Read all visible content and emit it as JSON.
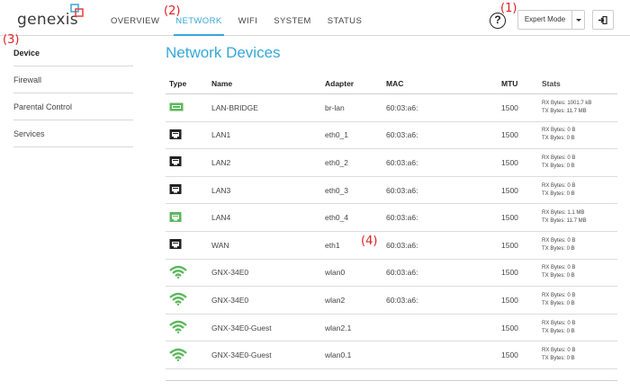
{
  "header": {
    "logo": "genexis",
    "nav": [
      {
        "label": "OVERVIEW",
        "active": false
      },
      {
        "label": "NETWORK",
        "active": true
      },
      {
        "label": "WIFI",
        "active": false
      },
      {
        "label": "SYSTEM",
        "active": false
      },
      {
        "label": "STATUS",
        "active": false
      }
    ],
    "help": "?",
    "mode_button": "Expert Mode",
    "logout_icon": "logout-icon"
  },
  "markers": [
    "(1)",
    "(2)",
    "(3)",
    "(4)"
  ],
  "sidebar": {
    "items": [
      {
        "label": "Device",
        "active": true
      },
      {
        "label": "Firewall",
        "active": false
      },
      {
        "label": "Parental Control",
        "active": false
      },
      {
        "label": "Services",
        "active": false
      }
    ]
  },
  "main": {
    "title": "Network Devices",
    "columns": [
      "Type",
      "Name",
      "Adapter",
      "MAC",
      "MTU",
      "Stats"
    ],
    "rows": [
      {
        "type": "bridge-icon",
        "name": "LAN-BRIDGE",
        "adapter": "br-lan",
        "mac": "60:03:a6:",
        "mtu": "1500",
        "rx": "RX Bytes: 1001.7 kB",
        "tx": "TX Bytes: 11.7 MB"
      },
      {
        "type": "ethernet-icon",
        "name": "LAN1",
        "adapter": "eth0_1",
        "mac": "60:03:a6:",
        "mtu": "1500",
        "rx": "RX Bytes: 0 B",
        "tx": "TX Bytes: 0 B"
      },
      {
        "type": "ethernet-icon",
        "name": "LAN2",
        "adapter": "eth0_2",
        "mac": "60:03:a6:",
        "mtu": "1500",
        "rx": "RX Bytes: 0 B",
        "tx": "TX Bytes: 0 B"
      },
      {
        "type": "ethernet-icon",
        "name": "LAN3",
        "adapter": "eth0_3",
        "mac": "60:03:a6:",
        "mtu": "1500",
        "rx": "RX Bytes: 0 B",
        "tx": "TX Bytes: 0 B"
      },
      {
        "type": "ethernet-active-icon",
        "name": "LAN4",
        "adapter": "eth0_4",
        "mac": "60:03:a6:",
        "mtu": "1500",
        "rx": "RX Bytes: 1.1 MB",
        "tx": "TX Bytes: 11.7 MB"
      },
      {
        "type": "ethernet-icon",
        "name": "WAN",
        "adapter": "eth1",
        "mac": "60:03:a6:",
        "mtu": "1500",
        "rx": "RX Bytes: 0 B",
        "tx": "TX Bytes: 0 B"
      },
      {
        "type": "wifi-icon",
        "name": "GNX-34E0",
        "adapter": "wlan0",
        "mac": "60:03:a6:",
        "mtu": "1500",
        "rx": "RX Bytes: 0 B",
        "tx": "TX Bytes: 0 B"
      },
      {
        "type": "wifi-icon",
        "name": "GNX-34E0",
        "adapter": "wlan2",
        "mac": "60:03:a6:",
        "mtu": "1500",
        "rx": "RX Bytes: 0 B",
        "tx": "TX Bytes: 0 B"
      },
      {
        "type": "wifi-icon",
        "name": "GNX-34E0-Guest",
        "adapter": "wlan2.1",
        "mac": "",
        "mtu": "1500",
        "rx": "RX Bytes: 0 B",
        "tx": "TX Bytes: 0 B"
      },
      {
        "type": "wifi-icon",
        "name": "GNX-34E0-Guest",
        "adapter": "wlan0.1",
        "mac": "",
        "mtu": "1500",
        "rx": "RX Bytes: 0 B",
        "tx": "TX Bytes: 0 B"
      }
    ]
  },
  "colors": {
    "accent": "#36a7d8",
    "green": "#5cb85c",
    "marker": "#e02020"
  }
}
